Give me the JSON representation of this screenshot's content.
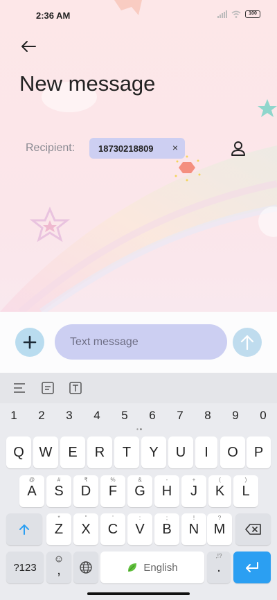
{
  "status_bar": {
    "time": "2:36 AM",
    "battery": "100"
  },
  "header": {
    "title": "New message"
  },
  "recipient": {
    "label": "Recipient:",
    "chip_value": "18730218809",
    "chip_remove": "×"
  },
  "compose": {
    "placeholder": "Text message",
    "add_symbol": "+"
  },
  "keyboard": {
    "numbers": [
      "1",
      "2",
      "3",
      "4",
      "5",
      "6",
      "7",
      "8",
      "9",
      "0"
    ],
    "row1": [
      "Q",
      "W",
      "E",
      "R",
      "T",
      "Y",
      "U",
      "I",
      "O",
      "P"
    ],
    "row2": [
      {
        "k": "A",
        "h": "@"
      },
      {
        "k": "S",
        "h": "#"
      },
      {
        "k": "D",
        "h": "₹"
      },
      {
        "k": "F",
        "h": "%"
      },
      {
        "k": "G",
        "h": "&"
      },
      {
        "k": "H",
        "h": "-"
      },
      {
        "k": "J",
        "h": "+"
      },
      {
        "k": "K",
        "h": "("
      },
      {
        "k": "L",
        "h": ")"
      }
    ],
    "row3": [
      {
        "k": "Z",
        "h": "*"
      },
      {
        "k": "X",
        "h": "\""
      },
      {
        "k": "C",
        "h": "'"
      },
      {
        "k": "V",
        "h": ":"
      },
      {
        "k": "B",
        "h": ";"
      },
      {
        "k": "N",
        "h": "!"
      },
      {
        "k": "M",
        "h": "?"
      }
    ],
    "symbols_key": "?123",
    "comma_key": ",",
    "space_label": "English",
    "period_key": ".",
    "period_hint": ",!?"
  },
  "colors": {
    "chip": "#cdcff2",
    "accent_blue": "#2b9ff2",
    "round_button": "#b9dcef"
  },
  "icons": [
    "back-arrow-icon",
    "contact-icon",
    "plus-icon",
    "send-arrow-icon",
    "shift-icon",
    "backspace-icon",
    "globe-icon",
    "leaf-icon",
    "enter-icon"
  ]
}
